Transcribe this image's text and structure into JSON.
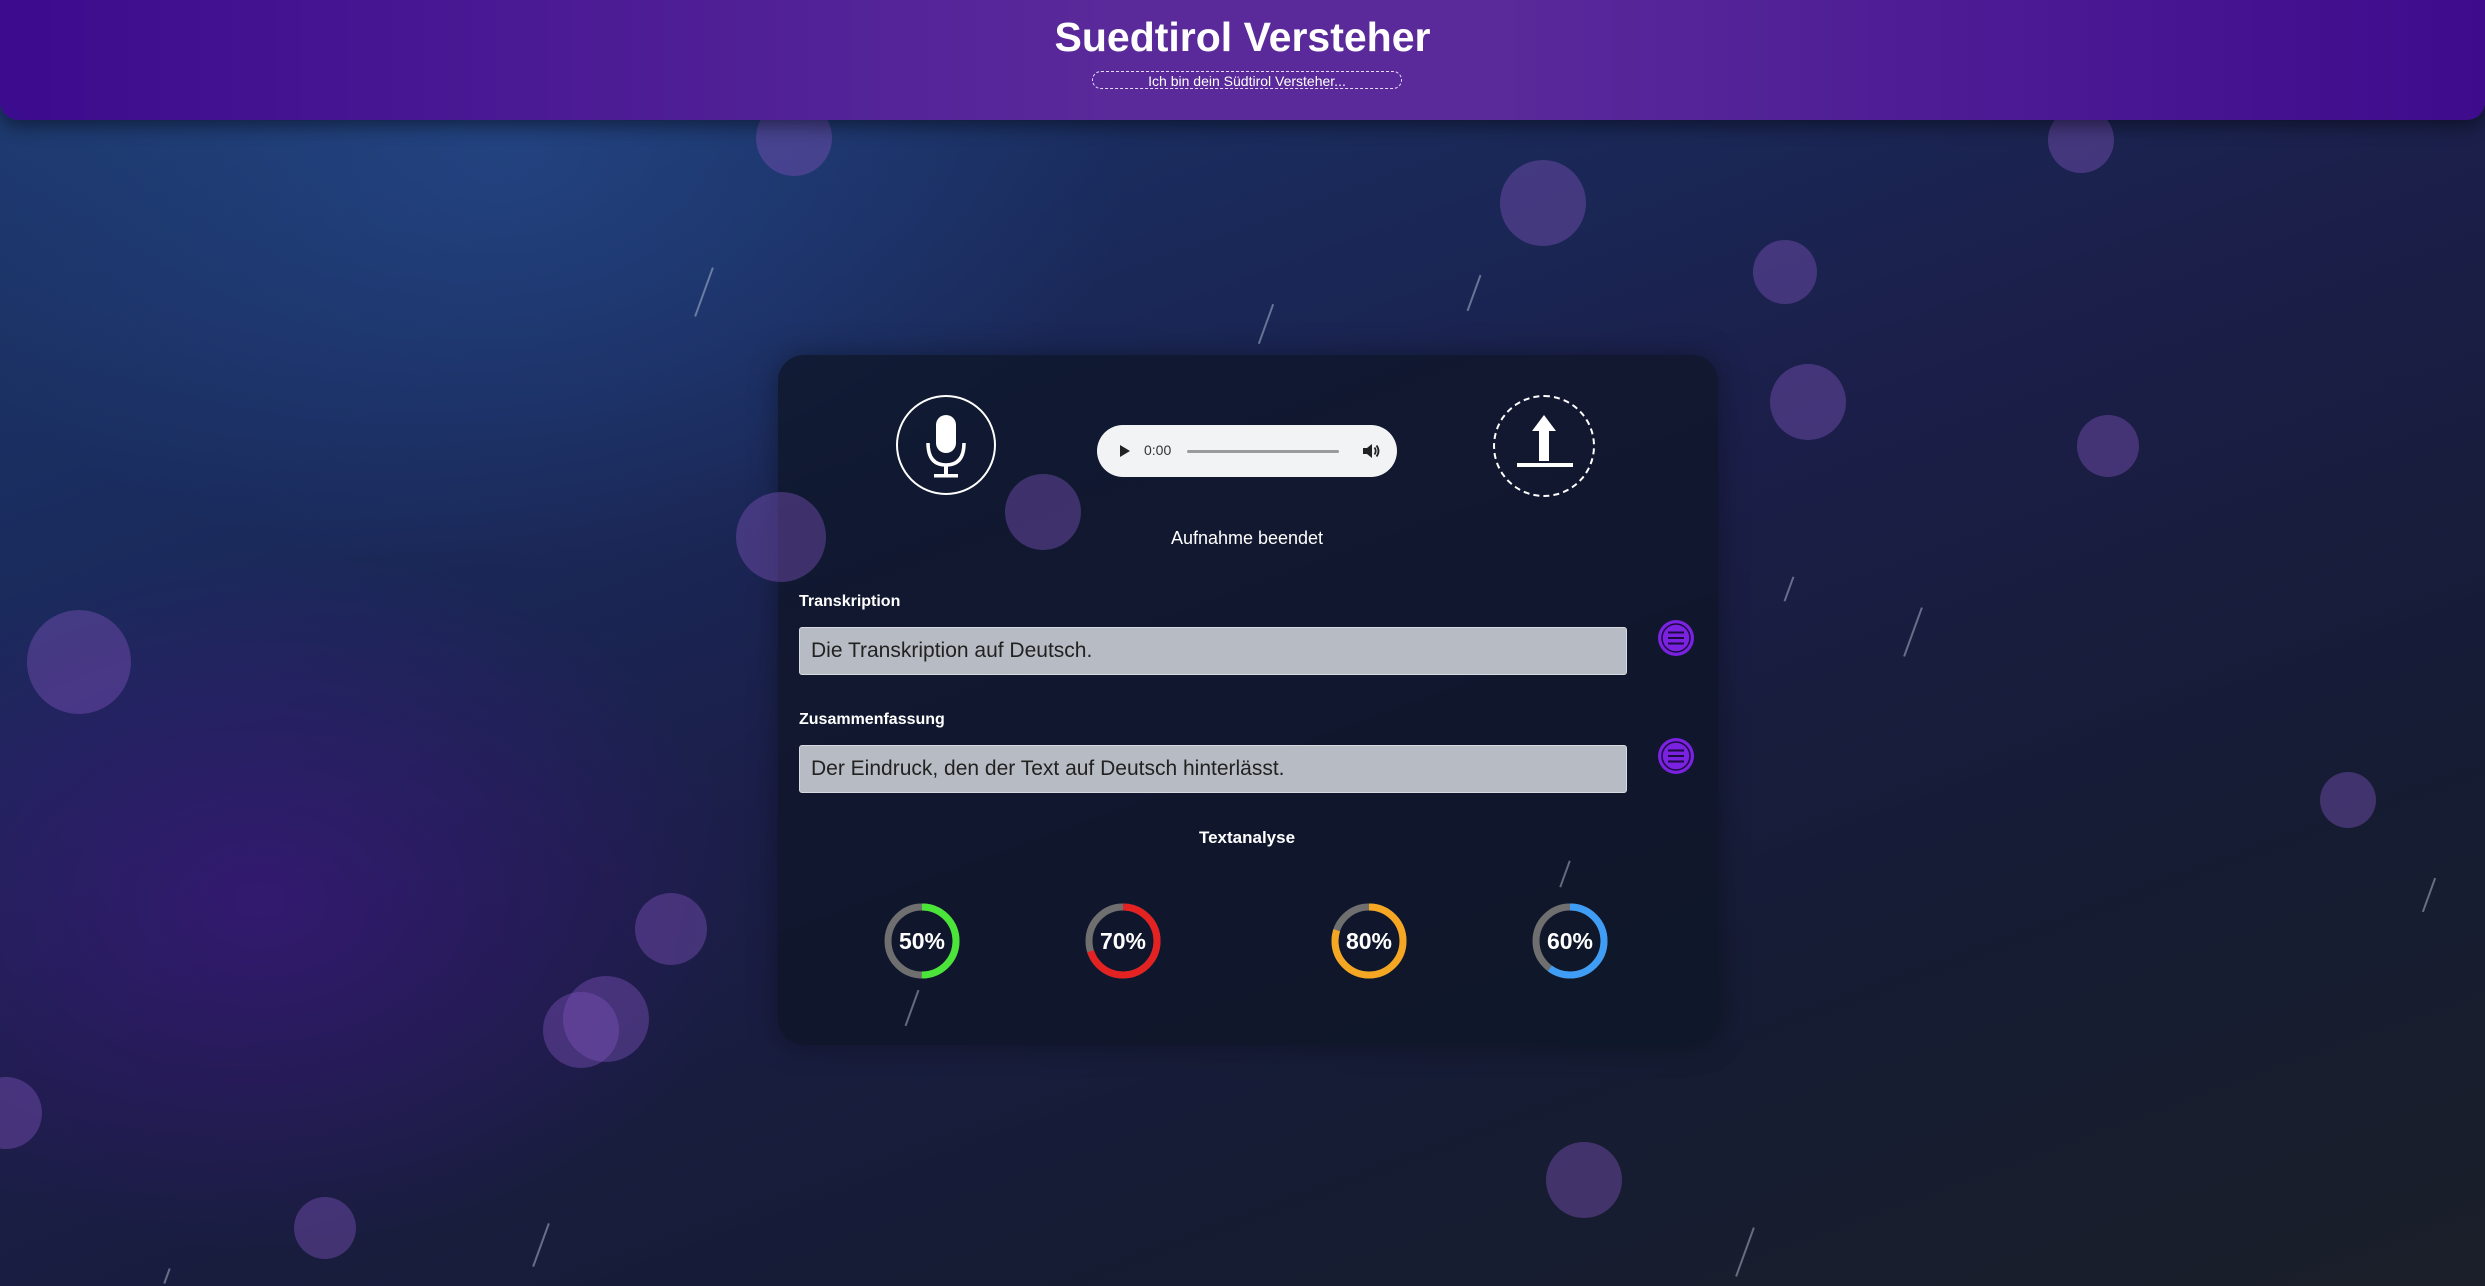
{
  "header": {
    "title": "Suedtirol Versteher",
    "subtitle": "Ich bin dein Südtirol Versteher..."
  },
  "recorder": {
    "mic_icon": "microphone-icon",
    "upload_icon": "upload-icon",
    "audio_time": "0:00",
    "status": "Aufnahme beendet"
  },
  "transcription": {
    "label": "Transkription",
    "value": "Die Transkription auf Deutsch.",
    "menu_icon": "list-icon"
  },
  "summary": {
    "label": "Zusammenfassung",
    "value": "Der Eindruck, den der Text auf Deutsch hinterlässt.",
    "menu_icon": "list-icon"
  },
  "analysis": {
    "title": "Textanalyse",
    "gauges": [
      {
        "label": "50%",
        "value": 50,
        "color": "#4be53a"
      },
      {
        "label": "70%",
        "value": 70,
        "color": "#e52222"
      },
      {
        "label": "80%",
        "value": 80,
        "color": "#f5a623"
      },
      {
        "label": "60%",
        "value": 60,
        "color": "#3f9df5"
      }
    ]
  },
  "colors": {
    "header_accent": "#5a2a9b",
    "button_accent": "#7a22e0"
  }
}
